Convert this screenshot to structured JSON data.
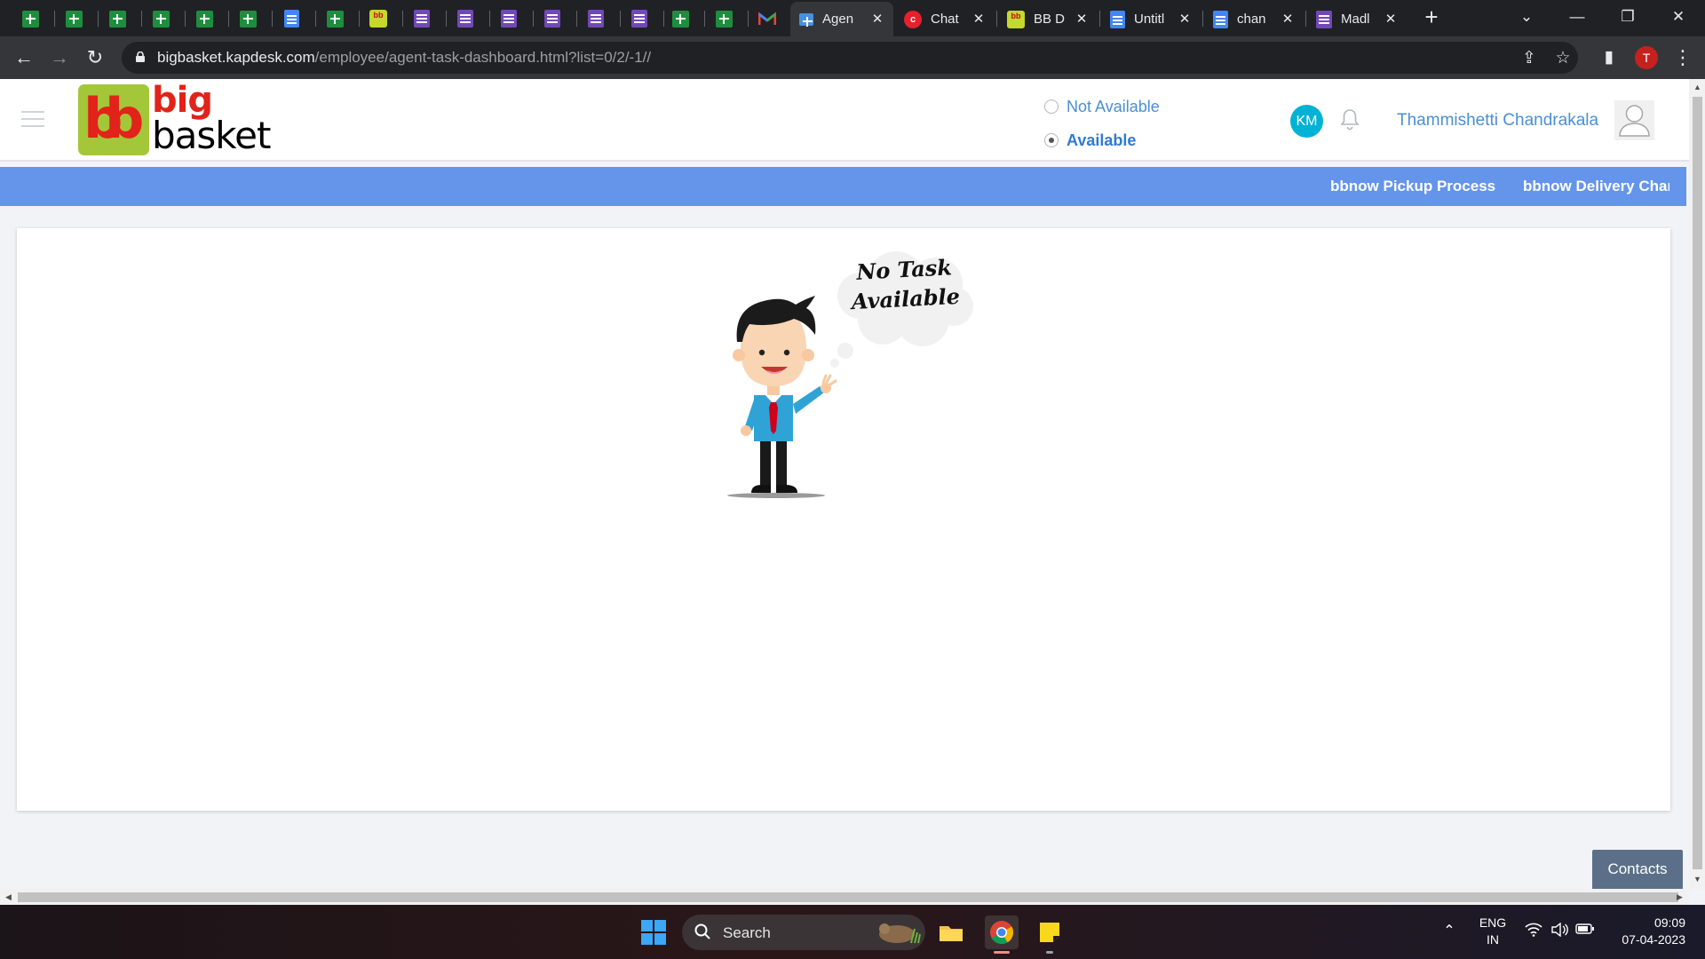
{
  "browser": {
    "tabs": [
      {
        "icon": "sheets-icon",
        "title": "Agen",
        "active": true
      },
      {
        "icon": "chat-icon",
        "title": "Chat"
      },
      {
        "icon": "bbdaily-icon",
        "title": "BB D"
      },
      {
        "icon": "docs-icon",
        "title": "Untitl"
      },
      {
        "icon": "docs-icon",
        "title": "chan"
      },
      {
        "icon": "forms-icon",
        "title": "Madl"
      }
    ],
    "url_host": "bigbasket.kapdesk.com",
    "url_path": "/employee/agent-task-dashboard.html?list=0/2/-1//",
    "profile_initial": "T"
  },
  "header": {
    "logo_big": "big",
    "logo_basket": "basket",
    "status_options": [
      {
        "label": "Not Available",
        "selected": false
      },
      {
        "label": "Available",
        "selected": true
      }
    ],
    "avatar_initials": "KM",
    "username": "Thammishetti Chandrakala"
  },
  "nav": {
    "links": [
      "bbnow Pickup Process",
      "bbnow Delivery Charg"
    ]
  },
  "main": {
    "empty_state_line1": "No Task",
    "empty_state_line2": "Available"
  },
  "contacts_label": "Contacts",
  "taskbar": {
    "search_placeholder": "Search",
    "lang_line1": "ENG",
    "lang_line2": "IN",
    "time": "09:09",
    "date": "07-04-2023"
  },
  "colors": {
    "accent_blue": "#6495ea",
    "brand_red": "#e2231a",
    "brand_green": "#a4c639",
    "link_blue": "#4a8fd4"
  }
}
